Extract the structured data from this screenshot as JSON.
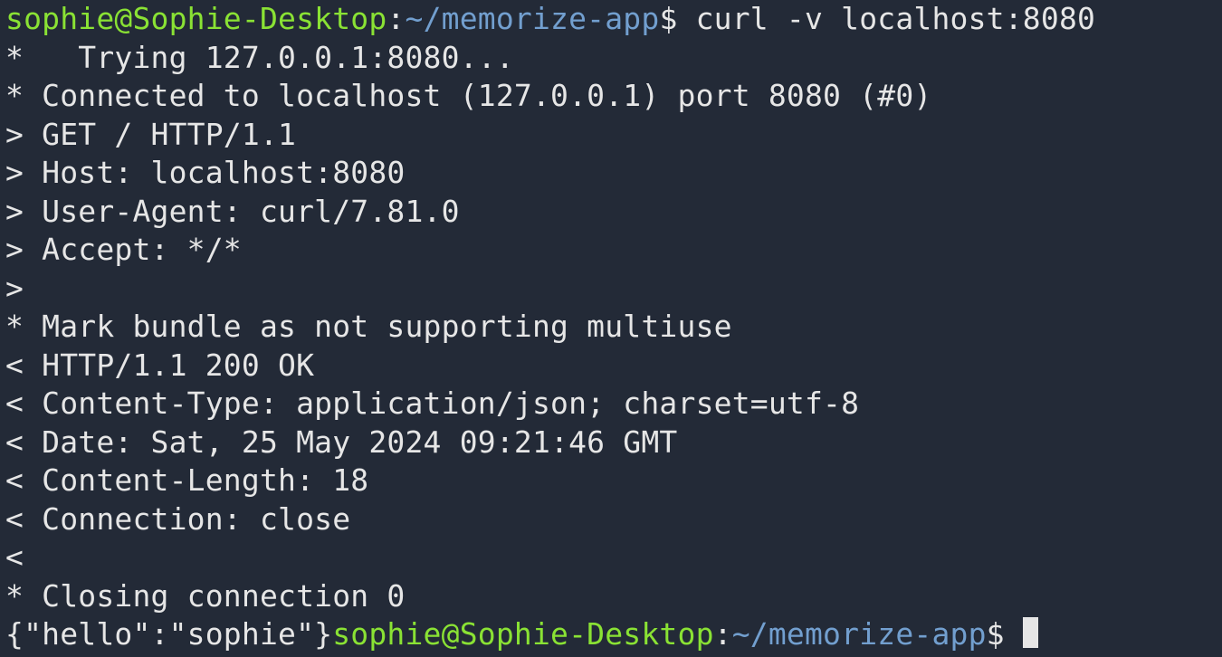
{
  "prompt1": {
    "user_host": "sophie@Sophie-Desktop",
    "colon": ":",
    "path": "~/memorize-app",
    "dollar": "$ "
  },
  "command": "curl -v localhost:8080",
  "output_lines": [
    "*   Trying 127.0.0.1:8080...",
    "* Connected to localhost (127.0.0.1) port 8080 (#0)",
    "> GET / HTTP/1.1",
    "> Host: localhost:8080",
    "> User-Agent: curl/7.81.0",
    "> Accept: */*",
    "> ",
    "* Mark bundle as not supporting multiuse",
    "< HTTP/1.1 200 OK",
    "< Content-Type: application/json; charset=utf-8",
    "< Date: Sat, 25 May 2024 09:21:46 GMT",
    "< Content-Length: 18",
    "< Connection: close",
    "< ",
    "* Closing connection 0"
  ],
  "response_body": "{\"hello\":\"sophie\"}",
  "prompt2": {
    "user_host": "sophie@Sophie-Desktop",
    "colon": ":",
    "path": "~/memorize-app",
    "dollar": "$ "
  },
  "colors": {
    "background": "#232a37",
    "foreground": "#e6e6e6",
    "prompt_user": "#8ae234",
    "prompt_path": "#729fcf"
  }
}
